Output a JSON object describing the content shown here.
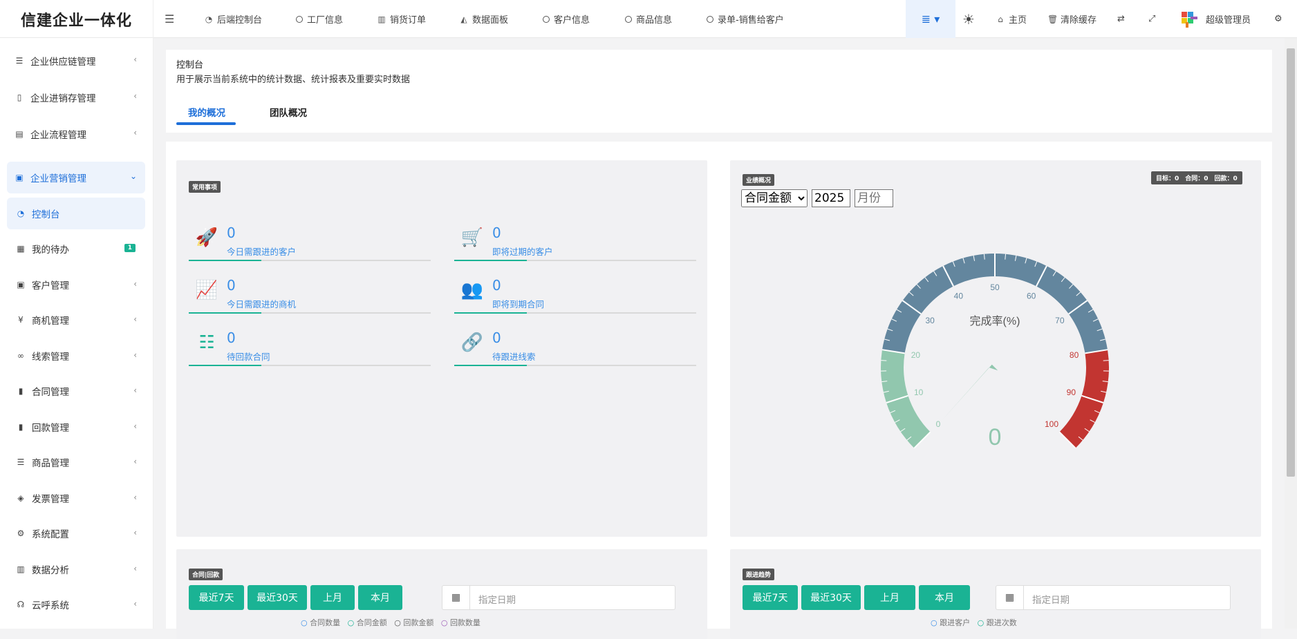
{
  "app": {
    "logo": "信建企业一体化"
  },
  "topnav": [
    {
      "icon": "dashboard-icon",
      "label": "后端控制台"
    },
    {
      "icon": "circle-icon",
      "label": "工厂信息"
    },
    {
      "icon": "bar-chart-icon",
      "label": "销货订单"
    },
    {
      "icon": "area-chart-icon",
      "label": "数据面板"
    },
    {
      "icon": "circle-icon",
      "label": "客户信息"
    },
    {
      "icon": "circle-icon",
      "label": "商品信息"
    },
    {
      "icon": "circle-icon",
      "label": "录单-销售给客户"
    }
  ],
  "topright": {
    "home": "主页",
    "clear_cache": "清除缓存",
    "user": "超级管理员"
  },
  "sidebar": {
    "groups": [
      {
        "label": "企业供应链管理",
        "icon": "list-icon"
      },
      {
        "label": "企业进销存管理",
        "icon": "file-icon"
      },
      {
        "label": "企业流程管理",
        "icon": "window-icon"
      },
      {
        "label": "企业营销管理",
        "icon": "id-card-icon",
        "active": true
      }
    ],
    "items": [
      {
        "label": "控制台",
        "icon": "dashboard-icon",
        "active": true
      },
      {
        "label": "我的待办",
        "icon": "calendar-check-icon",
        "badge": "1"
      },
      {
        "label": "客户管理",
        "icon": "id-card-icon"
      },
      {
        "label": "商机管理",
        "icon": "yen-icon"
      },
      {
        "label": "线索管理",
        "icon": "link-icon"
      },
      {
        "label": "合同管理",
        "icon": "bookmark-icon"
      },
      {
        "label": "回款管理",
        "icon": "bookmark-icon"
      },
      {
        "label": "商品管理",
        "icon": "list-icon"
      },
      {
        "label": "发票管理",
        "icon": "ticket-icon"
      },
      {
        "label": "系统配置",
        "icon": "cogs-icon"
      },
      {
        "label": "数据分析",
        "icon": "bar-chart-icon"
      },
      {
        "label": "云呼系统",
        "icon": "headset-icon"
      }
    ]
  },
  "header": {
    "title": "控制台",
    "subtitle": "用于展示当前系统中的统计数据、统计报表及重要实时数据",
    "tabs": [
      {
        "label": "我的概况",
        "active": true
      },
      {
        "label": "团队概况"
      }
    ]
  },
  "common": {
    "label": "常用事项",
    "stats": [
      {
        "icon": "rocket-icon",
        "value": "0",
        "text": "今日需跟进的客户"
      },
      {
        "icon": "cart-icon",
        "value": "0",
        "text": "即将过期的客户"
      },
      {
        "icon": "line-chart-icon",
        "value": "0",
        "text": "今日需跟进的商机"
      },
      {
        "icon": "users-icon",
        "value": "0",
        "text": "即将到期合同"
      },
      {
        "icon": "list-alt-icon",
        "value": "0",
        "text": "待回款合同"
      },
      {
        "icon": "chain-icon",
        "value": "0",
        "text": "待跟进线索"
      }
    ]
  },
  "performance": {
    "label": "业绩概况",
    "summary": "目标：0　合同：0　回款：0",
    "select_value": "合同金额",
    "year": "2025",
    "month_placeholder": "月份",
    "gauge": {
      "title": "完成率(%)",
      "value": 0,
      "min": 0,
      "max": 100,
      "ticks": [
        "0",
        "10",
        "20",
        "30",
        "40",
        "50",
        "60",
        "70",
        "80",
        "90",
        "100"
      ]
    }
  },
  "contract": {
    "label": "合同|回款",
    "buttons": [
      "最近7天",
      "最近30天",
      "上月",
      "本月"
    ],
    "date_placeholder": "指定日期",
    "legend": [
      "合同数量",
      "合同金额",
      "回款金额",
      "回款数量"
    ]
  },
  "trend": {
    "label": "跟进趋势",
    "buttons": [
      "最近7天",
      "最近30天",
      "上月",
      "本月"
    ],
    "date_placeholder": "指定日期",
    "legend": [
      "跟进客户",
      "跟进次数"
    ]
  },
  "colors": {
    "accent": "#1ab394",
    "blue": "#1e6fd9",
    "gauge_low": "#91c7ae",
    "gauge_mid": "#63869e",
    "gauge_high": "#c23531"
  }
}
